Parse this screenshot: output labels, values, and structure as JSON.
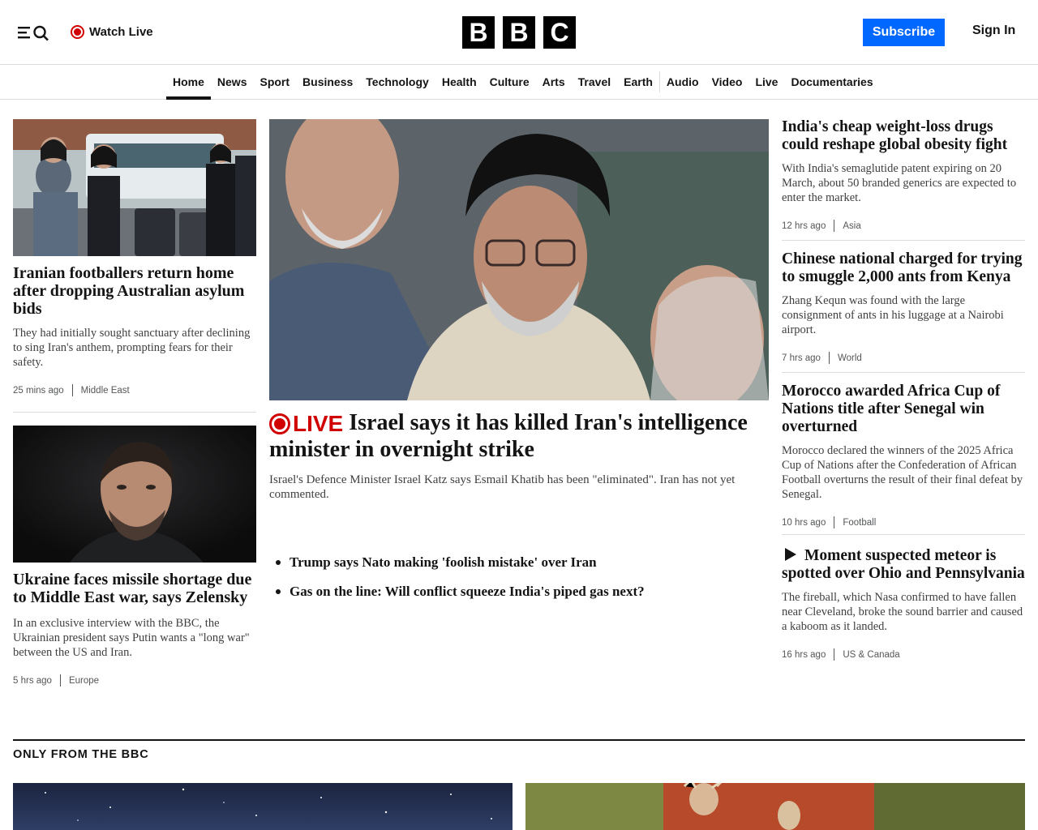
{
  "header": {
    "watch_live": "Watch Live",
    "logo": [
      "B",
      "B",
      "C"
    ],
    "subscribe": "Subscribe",
    "sign_in": "Sign In"
  },
  "nav": {
    "items": [
      "Home",
      "News",
      "Sport",
      "Business",
      "Technology",
      "Health",
      "Culture",
      "Arts",
      "Travel",
      "Earth",
      "Audio",
      "Video",
      "Live",
      "Documentaries"
    ],
    "active": "Home"
  },
  "left": [
    {
      "headline": "Iranian footballers return home after dropping Australian asylum bids",
      "summary": "They had initially sought sanctuary after declining to sing Iran's anthem, prompting fears for their safety.",
      "time": "25 mins ago",
      "tag": "Middle East"
    },
    {
      "headline": "Ukraine faces missile shortage due to Middle East war, says Zelensky",
      "summary": "In an exclusive interview with the BBC, the Ukrainian president says Putin wants a \"long war\" between the US and Iran.",
      "time": "5 hrs ago",
      "tag": "Europe"
    }
  ],
  "main": {
    "live_label": "LIVE",
    "headline": "Israel says it has killed Iran's intelligence minister in overnight strike",
    "summary": "Israel's Defence Minister Israel Katz says Esmail Khatib has been \"eliminated\". Iran has not yet commented.",
    "bullets": [
      "Trump says Nato making 'foolish mistake' over Iran",
      "Gas on the line: Will conflict squeeze India's piped gas next?"
    ]
  },
  "right": [
    {
      "headline": "India's cheap weight-loss drugs could reshape global obesity fight",
      "summary": "With India's semaglutide patent expiring on 20 March, about 50 branded generics are expected to enter the market.",
      "time": "12 hrs ago",
      "tag": "Asia"
    },
    {
      "headline": "Chinese national charged for trying to smuggle 2,000 ants from Kenya",
      "summary": "Zhang Kequn was found with the large consignment of ants in his luggage at a Nairobi airport.",
      "time": "7 hrs ago",
      "tag": "World"
    },
    {
      "headline": "Morocco awarded Africa Cup of Nations title after Senegal win overturned",
      "summary": "Morocco declared the winners of the 2025 Africa Cup of Nations after the Confederation of African Football overturns the result of their final defeat by Senegal.",
      "time": "10 hrs ago",
      "tag": "Football"
    },
    {
      "headline": "Moment suspected meteor is spotted over Ohio and Pennsylvania",
      "summary": "The fireball, which Nasa confirmed to have fallen near Cleveland, broke the sound barrier and caused a kaboom as it landed.",
      "time": "16 hrs ago",
      "tag": "US & Canada",
      "icon": "play-icon"
    }
  ],
  "section": {
    "title": "ONLY FROM THE BBC"
  },
  "colors": {
    "live_red": "#d10000",
    "subscribe_blue": "#0068ff",
    "text": "#141414"
  }
}
